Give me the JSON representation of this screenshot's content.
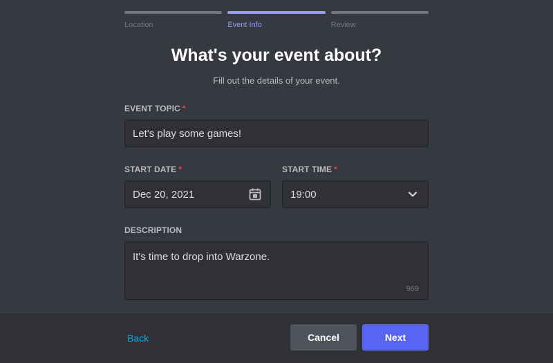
{
  "steps": [
    {
      "label": "Location",
      "active": false
    },
    {
      "label": "Event Info",
      "active": true
    },
    {
      "label": "Review",
      "active": false
    }
  ],
  "header": {
    "title": "What's your event about?",
    "subtitle": "Fill out the details of your event."
  },
  "form": {
    "topic": {
      "label": "EVENT TOPIC",
      "required_mark": "*",
      "value": "Let's play some games!"
    },
    "start_date": {
      "label": "START DATE",
      "required_mark": "*",
      "value": "Dec 20, 2021",
      "icon": "calendar-icon"
    },
    "start_time": {
      "label": "START TIME",
      "required_mark": "*",
      "value": "19:00",
      "icon": "chevron-down-icon"
    },
    "description": {
      "label": "DESCRIPTION",
      "value": "It's time to drop into Warzone.",
      "counter": "969"
    }
  },
  "footer": {
    "back_label": "Back",
    "cancel_label": "Cancel",
    "next_label": "Next"
  },
  "colors": {
    "background": "#36393f",
    "footer": "#2f3136",
    "accent": "#5865f2",
    "active_step": "#949cf7",
    "link": "#00aff4",
    "required": "#ed4245"
  }
}
